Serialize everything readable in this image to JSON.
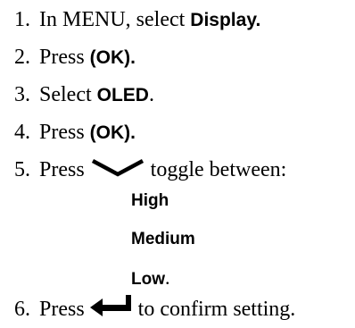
{
  "steps": [
    {
      "num": "1.",
      "text": "In MENU, select ",
      "bold": "Display."
    },
    {
      "num": "2.",
      "text": "Press ",
      "bold": "(OK)."
    },
    {
      "num": "3.",
      "text": "Select ",
      "bold": "OLED",
      "after": "."
    },
    {
      "num": "4.",
      "text": "Press ",
      "bold": "(OK)."
    },
    {
      "num": "5.",
      "text": "Press ",
      "after": "toggle between:",
      "icon": "chevron-down-icon"
    },
    {
      "num": "6.",
      "text": "Press ",
      "after": "to confirm setting.",
      "icon": "enter-arrow-icon"
    }
  ],
  "options": [
    "High",
    "Medium",
    "Low"
  ],
  "options_last_suffix": "."
}
